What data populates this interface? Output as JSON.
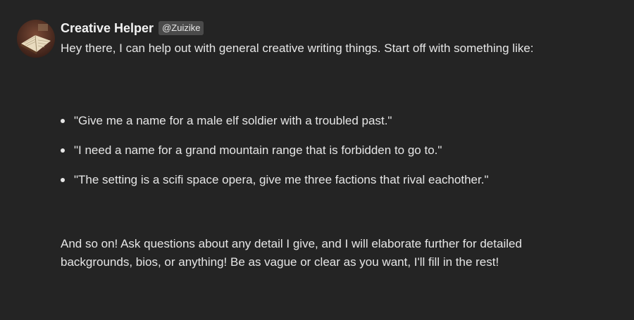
{
  "message": {
    "author": {
      "name": "Creative Helper",
      "handle": "@Zuizike",
      "avatar_icon": "open-book-icon"
    },
    "intro": "Hey there, I can help out with general creative writing things. Start off with something like:",
    "examples": [
      {
        "text": "\"Give me a name for a male elf soldier with a troubled past.\""
      },
      {
        "text": "\"I need a name for a grand mountain range that is forbidden to go to.\""
      },
      {
        "text": "\"The setting is a scifi space opera, give me three factions that rival eachother.\""
      }
    ],
    "outro": "And so on! Ask questions about any detail I give, and I will elaborate further for detailed backgrounds, bios, or anything! Be as vague or clear as you want, I'll fill in the rest!"
  },
  "colors": {
    "background": "#242424",
    "text": "#e6e6e6",
    "handle_badge": "#4a4a4a"
  }
}
